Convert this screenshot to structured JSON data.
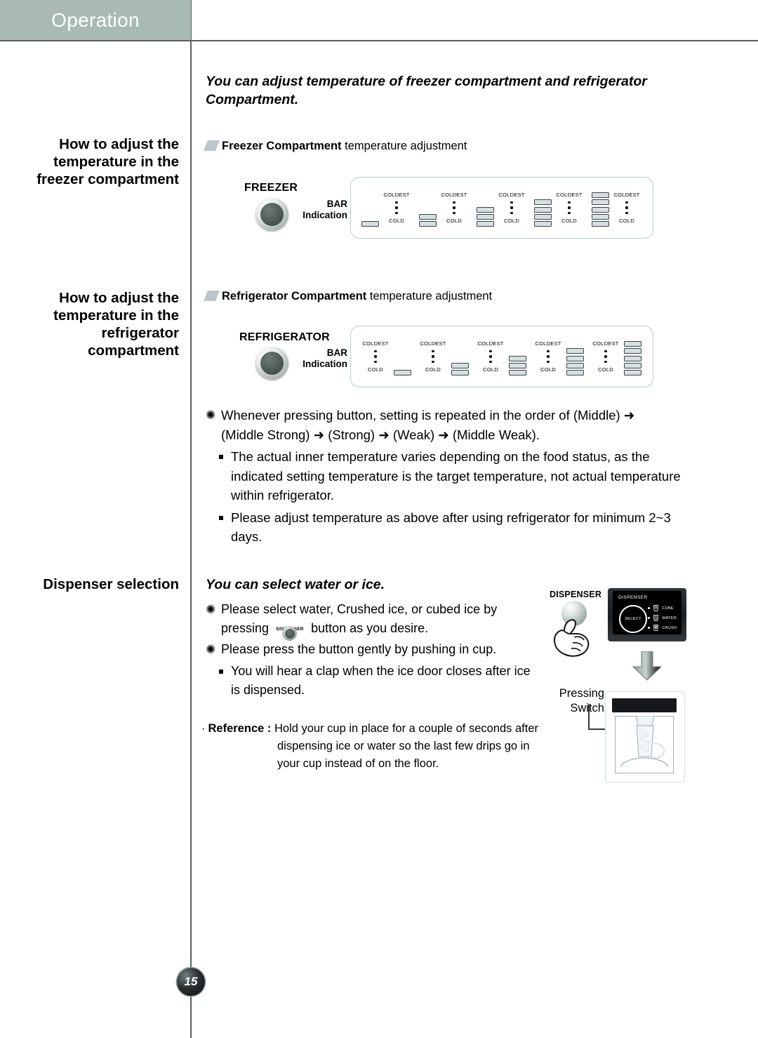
{
  "header": {
    "title": "Operation"
  },
  "page_number": "15",
  "intro_heading": "You can adjust temperature of freezer compartment and refrigerator Compartment.",
  "sidebar": {
    "freezer_heading": "How to adjust the temperature in the freezer compartment",
    "refrigerator_heading": "How to adjust the temperature in the refrigerator compartment",
    "dispenser_heading": "Dispenser selection"
  },
  "freezer_section": {
    "label_bold": "Freezer Compartment",
    "label_rest": " temperature adjustment",
    "knob_label": "FREEZER",
    "bar_indication_line1": "BAR",
    "bar_indication_line2": "Indication",
    "coldest_label": "COLDEST",
    "cold_label": "COLD",
    "bars_side": "left",
    "groups": [
      1,
      2,
      3,
      4,
      5
    ]
  },
  "refrigerator_section": {
    "label_bold": "Refrigerator Compartment",
    "label_rest": " temperature adjustment",
    "knob_label": "REFRIGERATOR",
    "bar_indication_line1": "BAR",
    "bar_indication_line2": "Indication",
    "coldest_label": "COLDEST",
    "cold_label": "COLD",
    "bars_side": "right",
    "groups": [
      1,
      2,
      3,
      4,
      5
    ]
  },
  "notes": {
    "order_note_line1": "Whenever pressing button, setting is repeated in the order of (Middle) ➜",
    "order_note_line2": "(Middle Strong) ➜  (Strong) ➜  (Weak) ➜  (Middle Weak).",
    "bullet1": "The actual inner temperature varies depending on the food status, as the indicated setting temperature is the target temperature, not actual temperature within refrigerator.",
    "bullet2": "Please adjust temperature as above after using refrigerator for minimum 2~3 days."
  },
  "dispenser": {
    "heading": "You can select water or ice.",
    "item1_pre": "Please select water, Crushed ice, or cubed ice by pressing",
    "item1_post": "button as you desire.",
    "inline_button_label": "DISPENSER",
    "inline_button_text": "SELECT",
    "item2": "Please press the button gently by pushing in cup.",
    "subitem": "You will hear a clap when the ice door closes after ice is dispensed.",
    "reference_label": "Reference :",
    "reference_line1": "Hold your cup in place for a couple of seconds after",
    "reference_line2": "dispensing ice or water so the last few drips go in",
    "reference_line3": "your cup instead of on the floor."
  },
  "illustration": {
    "dispenser_word": "DISPENSER",
    "panel_title": "DISPENSER",
    "select_text": "SELECT",
    "options": [
      {
        "name": "CUBE"
      },
      {
        "name": "WATER"
      },
      {
        "name": "CRUSH"
      }
    ],
    "pressing_switch_line1": "Pressing",
    "pressing_switch_line2": "Switch"
  },
  "colors": {
    "header_bg": "#a9bab6",
    "rule": "#5a5f60",
    "bar_fill": "#d6e0e3",
    "panel_border": "#b9ccd2",
    "slash_mark": "#b9c7c9"
  }
}
